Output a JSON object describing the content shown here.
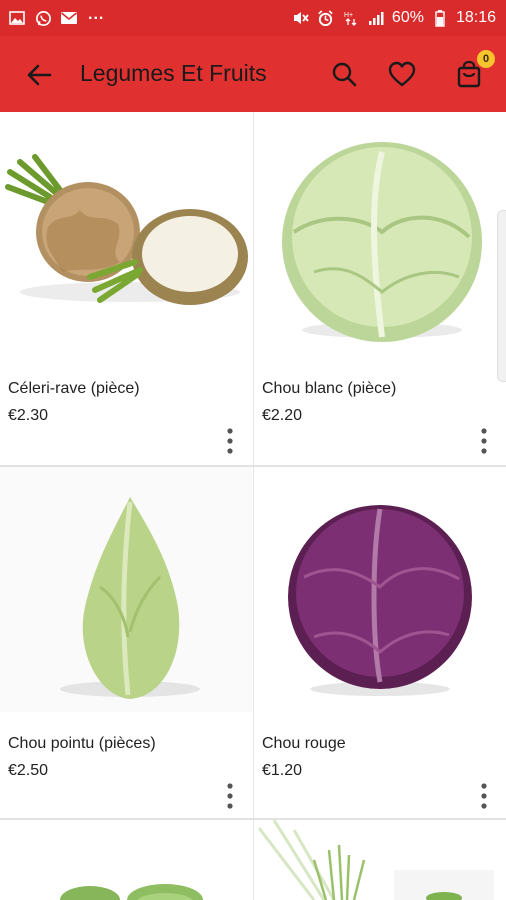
{
  "status_bar": {
    "left_icons": [
      "gallery-icon",
      "whatsapp-icon",
      "mail-icon"
    ],
    "more": "...",
    "battery": "60%",
    "time": "18:16"
  },
  "toolbar": {
    "title": "Legumes Et Fruits",
    "cart_count": "0",
    "colors": {
      "bar": "#e03030",
      "status": "#d92b2b",
      "badge": "#f6c42f"
    }
  },
  "products": [
    {
      "name": "Céleri-rave (pièce)",
      "price": "€2.30",
      "image": "celeriac"
    },
    {
      "name": "Chou blanc (pièce)",
      "price": "€2.20",
      "image": "white-cabbage"
    },
    {
      "name": "Chou pointu (pièces)",
      "price": "€2.50",
      "image": "pointed-cabbage"
    },
    {
      "name": "Chou rouge",
      "price": "€1.20",
      "image": "red-cabbage"
    },
    {
      "name": "",
      "price": "",
      "image": "green-vegetable"
    },
    {
      "name": "",
      "price": "",
      "image": "leek"
    }
  ]
}
